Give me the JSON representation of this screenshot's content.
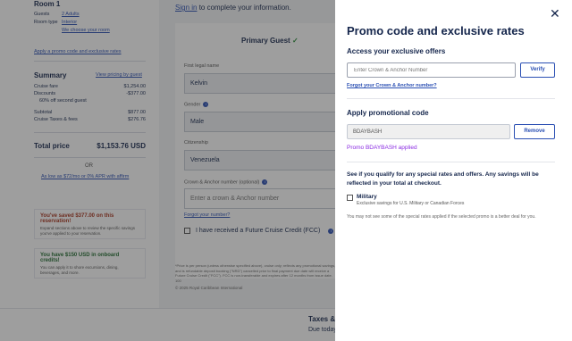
{
  "left": {
    "room_title": "Room 1",
    "guests_label": "Guests",
    "guests_value": "2 Adults",
    "room_type_label": "Room type",
    "room_type_value": "Interior",
    "room_note": "We choose your room",
    "apply_promo_link": "Apply a promo code and exclusive rates",
    "summary_title": "Summary",
    "summary_link": "View pricing by guest",
    "rows": [
      {
        "label": "Cruise fare",
        "value": "$1,254.00"
      },
      {
        "label": "Discounts",
        "value": "-$377.00"
      },
      {
        "label": "60% off second guest",
        "value": ""
      },
      {
        "label": "Subtotal",
        "value": "$877.00"
      },
      {
        "label": "Cruise Taxes & fees",
        "value": "$276.76"
      }
    ],
    "total_label": "Total price",
    "total_value": "$1,153.76 USD",
    "or_text": "OR",
    "affirm_text": "As low as $72/mo or 0% APR with affirm",
    "savings_title": "You've saved $377.00 on this reservation!",
    "savings_text": "Expand sections above to review the specific savings you've applied to your reservation.",
    "onboard_title": "You have $150 USD in onboard credits!",
    "onboard_text": "You can apply it to shore excursions, dining, beverages, and more."
  },
  "center": {
    "sign_in_link": "Sign in",
    "sign_in_rest": " to complete your information.",
    "guest_title": "Primary Guest",
    "first_name_label": "First legal name",
    "first_name_value": "Kelvin",
    "gender_label": "Gender",
    "gender_value": "Male",
    "citizenship_label": "Citizenship",
    "citizenship_value": "Venezuela",
    "crown_label": "Crown & Anchor number (optional)",
    "crown_placeholder": "Enter a crown & Anchor number",
    "forgot_number": "Forgot your number?",
    "fcc_label": "I have received a Future Cruise Credit (FCC)",
    "fine_print": "*Price is per person (unless otherwise specified above), cruise only; reflects any promotional savings, and is refundable deposit booking (\"NRD\") cancelled prior to final payment due date will receive a Future Cruise Credit (\"FCC\"). FCC is non-transferable and expires after 12 months from issue date. 100",
    "copyright": "© 2025 Royal Caribbean International"
  },
  "bottom": {
    "taxes": "Taxes & f",
    "due_today": "Due today"
  },
  "drawer": {
    "title": "Promo code and exclusive rates",
    "access_heading": "Access your exclusive offers",
    "crown_placeholder": "Enter Crown & Anchor Number",
    "verify_label": "Verify",
    "forgot_link": "Forgot your Crown & Anchor number?",
    "promo_heading": "Apply promotional code",
    "promo_value": "BDAYBASH",
    "remove_label": "Remove",
    "applied_text": "Promo BDAYBASH applied",
    "qualify_text": "See if you qualify for any special rates and offers. Any savings will be reflected in your total at checkout.",
    "military_label": "Military",
    "military_sub": "Exclusive savings for U.S. Military or Canadian Forces",
    "note": "You may not see some of the special rates applied if the selected promo is a better deal for you."
  },
  "colors": {
    "navy": "#15264c",
    "link_blue": "#2a4fb3",
    "promo_purple": "#8a2be2"
  }
}
